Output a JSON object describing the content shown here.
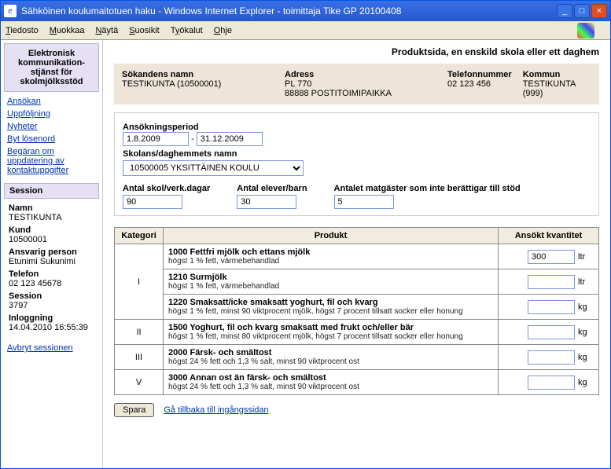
{
  "window": {
    "title": "Sähköinen koulumaitotuen haku - Windows Internet Explorer - toimittaja Tike GP 20100408"
  },
  "menu": {
    "items": [
      "Tiedosto",
      "Muokkaa",
      "Näytä",
      "Suosikit",
      "Työkalut",
      "Ohje"
    ]
  },
  "sidebar": {
    "heading": "Elektronisk kommunikation-stjänst för skolmjölksstöd",
    "links": [
      "Ansökan",
      "Uppföljning",
      "Nyheter",
      "Byt lösenord",
      "Begäran om uppdatering av kontaktuppgifter"
    ],
    "session_heading": "Session",
    "session": [
      {
        "label": "Namn",
        "value": "TESTIKUNTA"
      },
      {
        "label": "Kund",
        "value": "10500001"
      },
      {
        "label": "Ansvarig person",
        "value": "Etunimi Sukunimi"
      },
      {
        "label": "Telefon",
        "value": "02 123 45678"
      },
      {
        "label": "Session",
        "value": "3797"
      },
      {
        "label": "Inloggning",
        "value": "14.04.2010 16:55:39"
      }
    ],
    "end_session": "Avbryt sessionen"
  },
  "page": {
    "title": "Produktsida, en enskild skola eller ett daghem",
    "applicant": {
      "name_label": "Sökandens namn",
      "name_value": "TESTIKUNTA (10500001)",
      "address_label": "Adress",
      "address_line1": "PL 770",
      "address_line2": "88888 POSTITOIMIPAIKKA",
      "phone_label": "Telefonnummer",
      "phone_value": "02 123 456",
      "muni_label": "Kommun",
      "muni_value": "TESTIKUNTA (999)"
    },
    "form": {
      "period_label": "Ansökningsperiod",
      "period_from": "1.8.2009",
      "period_sep": "-",
      "period_to": "31.12.2009",
      "school_label": "Skolans/daghemmets namn",
      "school_value": "10500005 YKSITTÄINEN KOULU",
      "days_label": "Antal skol/verk.dagar",
      "days_value": "90",
      "children_label": "Antal elever/barn",
      "children_value": "30",
      "nonelig_label": "Antalet matgäster som inte berättigar till stöd",
      "nonelig_value": "5"
    },
    "table": {
      "head_cat": "Kategori",
      "head_prod": "Produkt",
      "head_qty": "Ansökt kvantitet",
      "rows": [
        {
          "cat": "",
          "name": "1000 Fettfri mjölk och ettans mjölk",
          "desc": "högst 1 % fett, värmebehandlad",
          "qty": "300",
          "unit": "ltr",
          "rowspan": 0
        },
        {
          "cat": "I",
          "name": "1210 Surmjölk",
          "desc": "högst 1 % fett, värmebehandlad",
          "qty": "",
          "unit": "ltr",
          "rowspan": 3
        },
        {
          "cat": "",
          "name": "1220 Smaksatt/icke smaksatt yoghurt, fil och kvarg",
          "desc": "högst 1 % fett, minst 90 viktprocent mjölk, högst 7 procent tillsatt socker eller honung",
          "qty": "",
          "unit": "kg",
          "rowspan": 0
        },
        {
          "cat": "II",
          "name": "1500 Yoghurt, fil och kvarg smaksatt med frukt och/eller bär",
          "desc": "högst 1 % fett, minst 80 viktprocent mjölk, högst 7 procent tillsatt socker eller honung",
          "qty": "",
          "unit": "kg",
          "rowspan": 1
        },
        {
          "cat": "III",
          "name": "2000 Färsk- och smältost",
          "desc": "högst 24 % fett och 1,3 % salt, minst 90 viktprocent ost",
          "qty": "",
          "unit": "kg",
          "rowspan": 1
        },
        {
          "cat": "V",
          "name": "3000 Annan ost än färsk- och smältost",
          "desc": "högst 24 % fett och 1,3 % salt, minst 90 viktprocent ost",
          "qty": "",
          "unit": "kg",
          "rowspan": 1
        }
      ]
    },
    "save_label": "Spara",
    "back_label": "Gå tillbaka till ingångssidan"
  }
}
